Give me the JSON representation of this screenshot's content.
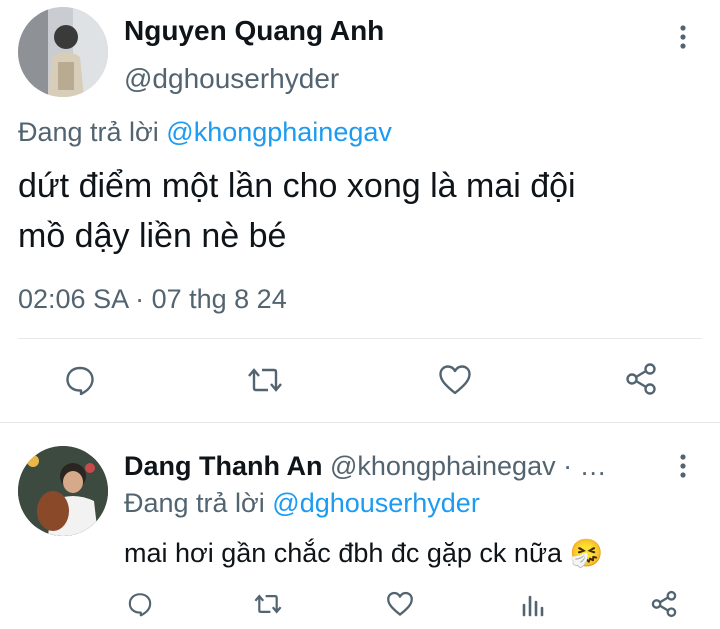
{
  "main_tweet": {
    "author_name": "Nguyen Quang Anh",
    "author_handle": "@dghouserhyder",
    "reply_prefix": "Đang trả lời",
    "reply_to": "@khongphainegav",
    "text_line1": "dứt điểm một lần cho xong là mai đội",
    "text_line2": "mồ dậy liền nè bé",
    "timestamp": "02:06 SA · 07 thg 8 24",
    "icons": [
      "more-vertical-icon",
      "reply-icon",
      "retweet-icon",
      "like-icon",
      "share-icon"
    ]
  },
  "reply_tweet": {
    "author_name": "Dang Thanh An",
    "author_handle": "@khongphainegav",
    "meta_suffix": "· …",
    "reply_prefix": "Đang trả lời",
    "reply_to": "@dghouserhyder",
    "text": "mai hơi gần chắc đbh đc gặp ck nữa",
    "emoji": "🤧",
    "icons": [
      "more-vertical-icon",
      "reply-icon",
      "retweet-icon",
      "like-icon",
      "views-icon",
      "share-icon"
    ]
  },
  "colors": {
    "link": "#1d9bf0",
    "muted": "#536471",
    "text": "#0f1419",
    "divider": "#e6e9eb"
  }
}
